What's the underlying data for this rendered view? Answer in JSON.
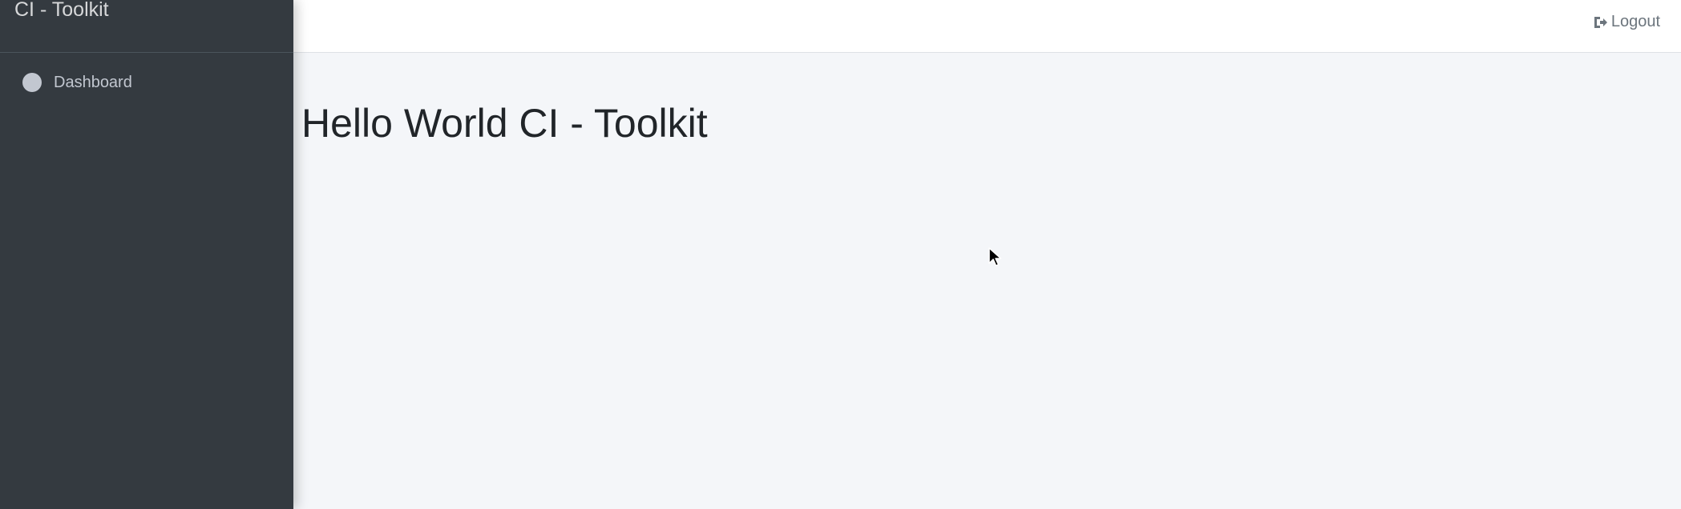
{
  "sidebar": {
    "brand": "CI - Toolkit",
    "items": [
      {
        "label": "Dashboard",
        "icon": "circle-icon"
      }
    ]
  },
  "topbar": {
    "logout_label": "Logout",
    "logout_icon": "sign-out-icon"
  },
  "main": {
    "title": "Hello World CI - Toolkit"
  },
  "colors": {
    "sidebar_bg": "#343a40",
    "content_bg": "#f4f6f9",
    "topbar_bg": "#ffffff",
    "nav_text": "#c2c7d0",
    "title_text": "#212529"
  }
}
